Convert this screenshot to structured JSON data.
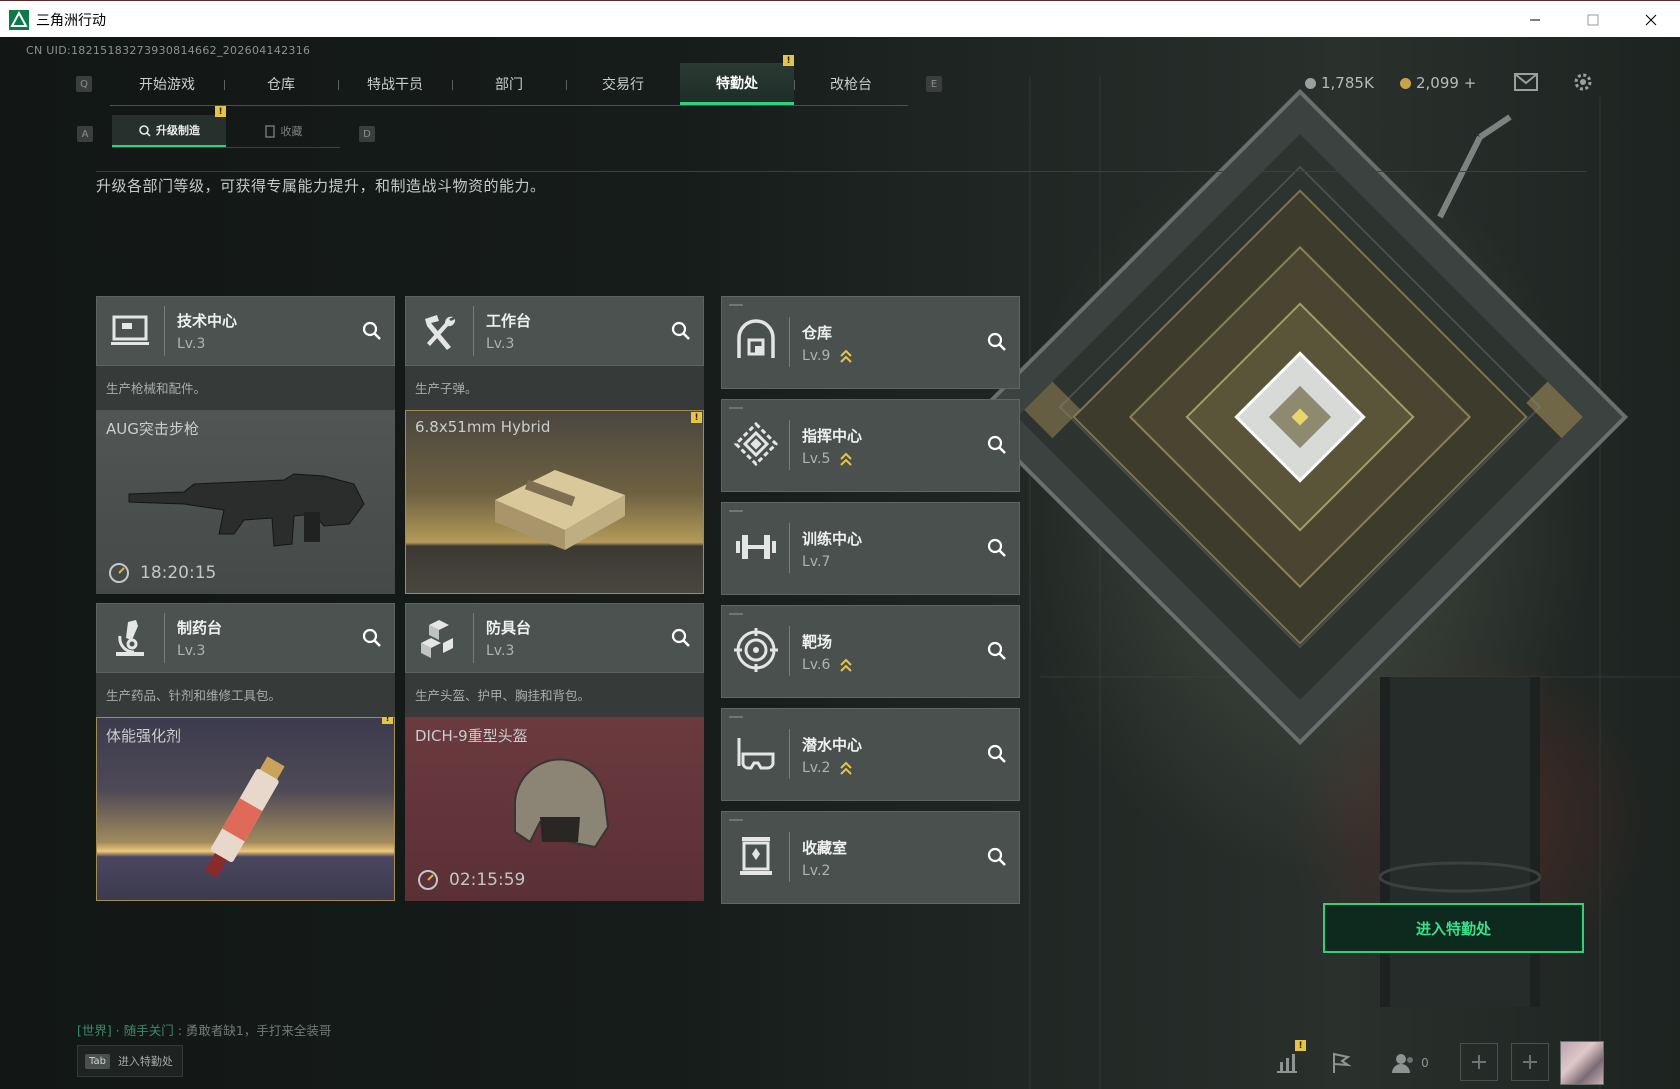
{
  "window": {
    "title": "三角洲行动"
  },
  "uid": "CN UID:18215183273930814662_202604142316",
  "nav": {
    "key_left": "Q",
    "key_right": "E",
    "tabs": [
      {
        "label": "开始游戏"
      },
      {
        "label": "仓库"
      },
      {
        "label": "特战干员"
      },
      {
        "label": "部门"
      },
      {
        "label": "交易行"
      },
      {
        "label": "特勤处",
        "active": true,
        "badge": "!"
      },
      {
        "label": "改枪台"
      }
    ]
  },
  "currency": {
    "silver": "1,785K",
    "gold": "2,099 +"
  },
  "subnav": {
    "key_left": "A",
    "key_right": "D",
    "tabs": [
      {
        "label": "升级制造",
        "active": true,
        "badge": "!"
      },
      {
        "label": "收藏"
      }
    ]
  },
  "description": "升级各部门等级，可获得专属能力提升，和制造战斗物资的能力。",
  "departments": [
    {
      "name": "技术中心",
      "level": "Lv.3",
      "desc": "生产枪械和配件。",
      "icon": "computer-icon",
      "craft": {
        "item": "AUG突击步枪",
        "timer": "18:20:15",
        "state": "in-progress"
      }
    },
    {
      "name": "工作台",
      "level": "Lv.3",
      "desc": "生产子弹。",
      "icon": "tools-icon",
      "craft": {
        "item": "6.8x51mm Hybrid",
        "timer": "",
        "state": "complete",
        "badge": "!"
      }
    },
    {
      "name": "制药台",
      "level": "Lv.3",
      "desc": "生产药品、针剂和维修工具包。",
      "icon": "microscope-icon",
      "craft": {
        "item": "体能强化剂",
        "timer": "",
        "state": "complete",
        "badge": "!"
      }
    },
    {
      "name": "防具台",
      "level": "Lv.3",
      "desc": "生产头盔、护甲、胸挂和背包。",
      "icon": "armor-blocks-icon",
      "craft": {
        "item": "DICH-9重型头盔",
        "timer": "02:15:59",
        "state": "in-progress"
      }
    }
  ],
  "facilities": [
    {
      "name": "仓库",
      "level": "Lv.9",
      "upgradable": true,
      "icon": "vault-icon"
    },
    {
      "name": "指挥中心",
      "level": "Lv.5",
      "upgradable": true,
      "icon": "command-icon"
    },
    {
      "name": "训练中心",
      "level": "Lv.7",
      "upgradable": false,
      "icon": "dumbbell-icon"
    },
    {
      "name": "靶场",
      "level": "Lv.6",
      "upgradable": true,
      "icon": "target-icon"
    },
    {
      "name": "潜水中心",
      "level": "Lv.2",
      "upgradable": true,
      "icon": "diving-mask-icon"
    },
    {
      "name": "收藏室",
      "level": "Lv.2",
      "upgradable": false,
      "icon": "trophy-case-icon"
    }
  ],
  "enter_button": "进入特勤处",
  "chat": {
    "channel": "[世界]",
    "sender": "随手关门",
    "message": "勇敢者缺1，手打来全装哥"
  },
  "tab_hint": {
    "key": "Tab",
    "label": "进入特勤处"
  },
  "bottom": {
    "friends_count": "0",
    "badge": "!"
  },
  "colors": {
    "accent": "#2fd17b",
    "badge": "#e6c44a",
    "upgrade_arrow": "#e6c44a"
  }
}
